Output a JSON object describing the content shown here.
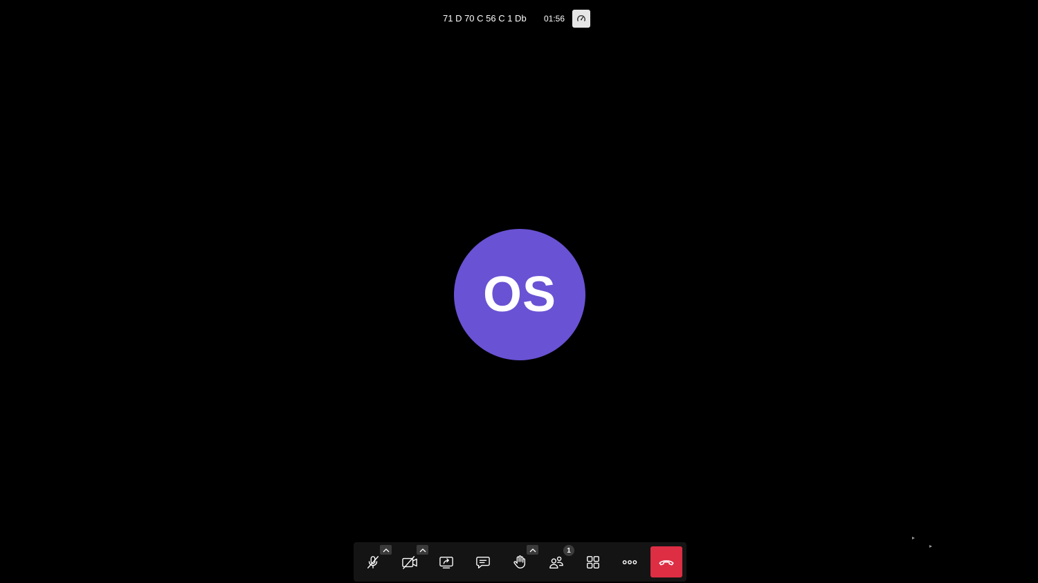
{
  "header": {
    "room_name": "71 D 70 C 56 C 1 Db",
    "timer": "01:56",
    "performance_icon": "speedometer-icon"
  },
  "participant": {
    "initials": "OS",
    "avatar_color": "#6a52d4"
  },
  "toolbar": {
    "buttons": [
      {
        "name": "microphone",
        "icon": "microphone-muted-icon",
        "has_caret": true
      },
      {
        "name": "camera",
        "icon": "camera-off-icon",
        "has_caret": true
      },
      {
        "name": "screen-share",
        "icon": "share-screen-icon",
        "has_caret": false
      },
      {
        "name": "chat",
        "icon": "chat-icon",
        "has_caret": false
      },
      {
        "name": "raise-hand",
        "icon": "hand-icon",
        "has_caret": true
      },
      {
        "name": "participants",
        "icon": "participants-icon",
        "has_caret": false
      },
      {
        "name": "tile-view",
        "icon": "grid-icon",
        "has_caret": false
      },
      {
        "name": "more",
        "icon": "more-icon",
        "has_caret": false
      },
      {
        "name": "hangup",
        "icon": "hangup-icon",
        "has_caret": false
      }
    ],
    "participant_count": "1",
    "hangup_color": "#dd2e44",
    "background_color": "#141414"
  }
}
